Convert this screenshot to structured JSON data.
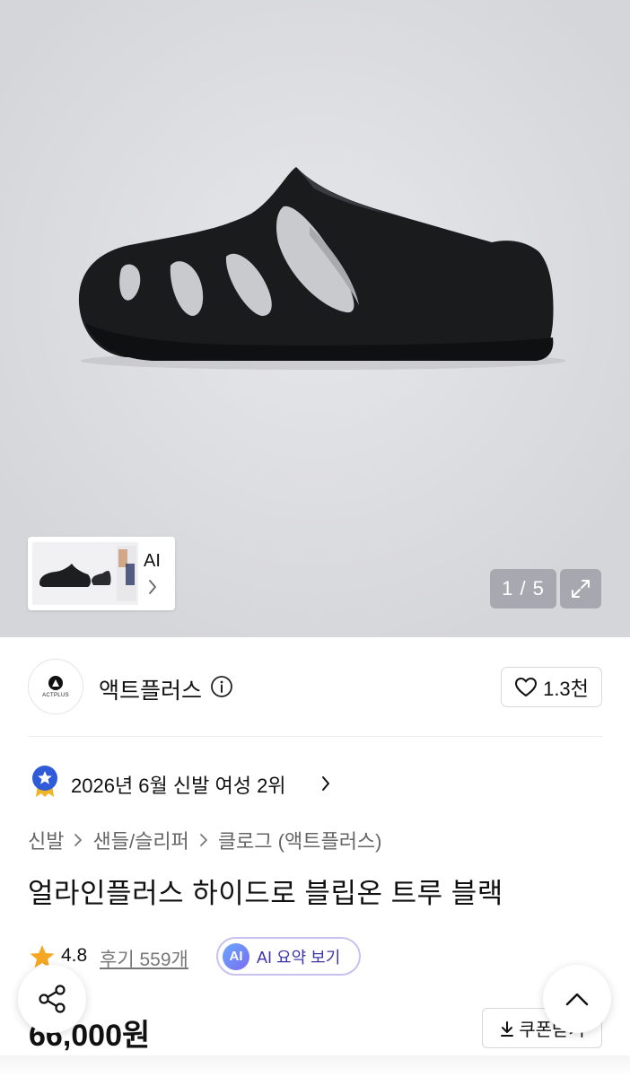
{
  "gallery": {
    "pager": "1 / 5",
    "thumbnail_ai_label": "AI"
  },
  "brand": {
    "logo_text": "ACTPLUS",
    "name": "액트플러스",
    "likes": "1.3천"
  },
  "ranking": {
    "text": "2026년 6월 신발 여성 2위"
  },
  "breadcrumb": [
    "신발",
    "샌들/슬리퍼",
    "클로그 (액트플러스)"
  ],
  "product": {
    "title": "얼라인플러스 하이드로 블립온 트루 블랙",
    "rating": "4.8",
    "reviews": "후기 559개",
    "ai_badge": "AI",
    "ai_summary": "AI 요약 보기",
    "price": "66,000원",
    "coupon": "쿠폰받기"
  },
  "colors": {
    "accent_purple": "#3b35a8",
    "star_orange": "#f5a623",
    "badge_blue": "#2f5bd8"
  }
}
